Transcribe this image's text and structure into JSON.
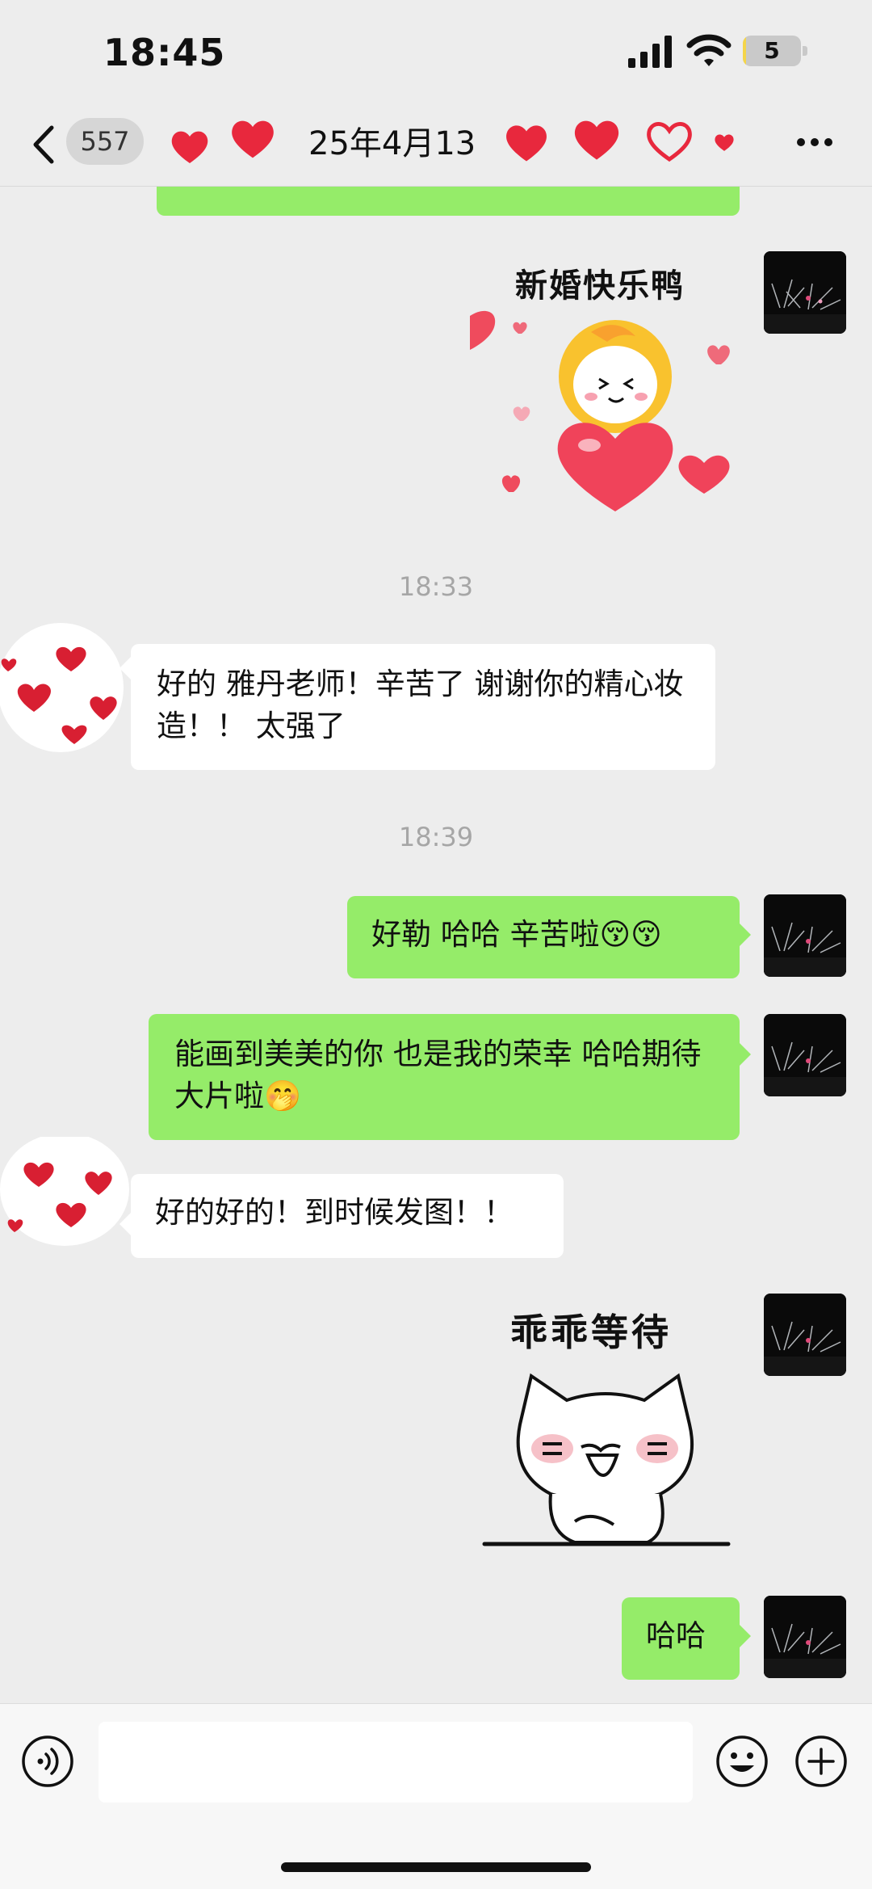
{
  "status_bar": {
    "time": "18:45",
    "battery": "5",
    "battery_level": 0.05
  },
  "header": {
    "unread_count": "557",
    "title": "25年4月13"
  },
  "messages": {
    "partial_top": "",
    "sticker1_caption": "新婚快乐鸭",
    "ts1": "18:33",
    "msg1": "好的 雅丹老师！辛苦了 谢谢你的精心妆造！！ 太强了",
    "ts2": "18:39",
    "msg2": "好勒 哈哈 辛苦啦😚😚",
    "msg3": "能画到美美的你 也是我的荣幸 哈哈期待大片啦🤭",
    "msg4": "好的好的！到时候发图！！",
    "sticker2_caption": "乖乖等待",
    "msg5": "哈哈"
  },
  "icons": {
    "back": "chevron-left-icon",
    "more": "more-dots-icon",
    "voice": "voice-icon",
    "emoji": "emoji-icon",
    "plus": "plus-icon"
  },
  "colors": {
    "background": "#ededed",
    "my_bubble": "#95ec69",
    "their_bubble": "#ffffff",
    "timestamp": "#a6a6a6",
    "heart": "#e8283d"
  }
}
